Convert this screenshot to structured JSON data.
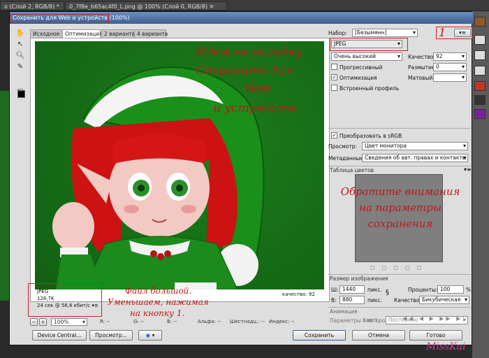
{
  "bg": {
    "tabs": [
      "о (Слой 2, RGB/8) *",
      "0_7f8e_b65ac4f0_L.png @ 100% (Слой 0, RGB/8)"
    ]
  },
  "dialog": {
    "title": "Сохранить для Web и устройств (100%)",
    "tabs": [
      "Исходное",
      "Оптимизация",
      "2 варианта",
      "4 варианта"
    ],
    "overlay_top": [
      "Идем во вкладку",
      "Сохранить для",
      "Web",
      "и устройств"
    ],
    "img_meta": [
      "JPEG",
      "128,7K",
      "24 сек @ 56,6 кбит/с"
    ],
    "quality_label": "качество: 92",
    "zoom": "100%",
    "status": {
      "r": "R: --",
      "g": "G: --",
      "b": "B: --",
      "alpha": "Альфа: --",
      "hex": "Шестнадц.: --",
      "index": "Индекс: --"
    },
    "bottom_annot": [
      "Файл большой.",
      "Уменьшаем, нажимая",
      "на кнопку 1."
    ]
  },
  "settings": {
    "preset_label": "Набор:",
    "preset_value": "[Безымянн]",
    "menu_annot": "1",
    "format": "JPEG",
    "quality_preset": "Очень высокий",
    "quality_label": "Качество:",
    "quality_value": "92",
    "blur_label": "Размытие:",
    "blur_value": "0",
    "progressive": "Прогрессивный",
    "optimized": "Оптимизация",
    "embed_profile": "Встроенный профиль",
    "matte_label": "Матовый:",
    "convert_srgb": "Преобразовать в sRGB",
    "preview_label": "Просмотр:",
    "preview_value": "Цвет монитора",
    "metadata_label": "Метаданные:",
    "metadata_value": "Сведения об авт. правах и контакты",
    "color_table": "Таблица цветов",
    "annot_right": [
      "Обратите внимания",
      "на параметры",
      "сохранения"
    ],
    "image_size": "Размер изображения",
    "w_label": "Ш:",
    "w_value": "1440",
    "h_label": "В:",
    "h_value": "880",
    "px": "пикс.",
    "percent_label": "Проценты:",
    "percent_value": "100",
    "percent_sign": "%",
    "resample_label": "Качество:",
    "resample_value": "Бикубическая",
    "animation": "Анимация",
    "loop_label": "Параметры повторов:",
    "loop_value": "Постоянно",
    "frame": "1 из 1"
  },
  "buttons": {
    "device": "Device Central...",
    "preview": "Просмотр...",
    "save": "Сохранить",
    "cancel": "Отмена",
    "done": "Готово"
  },
  "signature": "MissKai"
}
